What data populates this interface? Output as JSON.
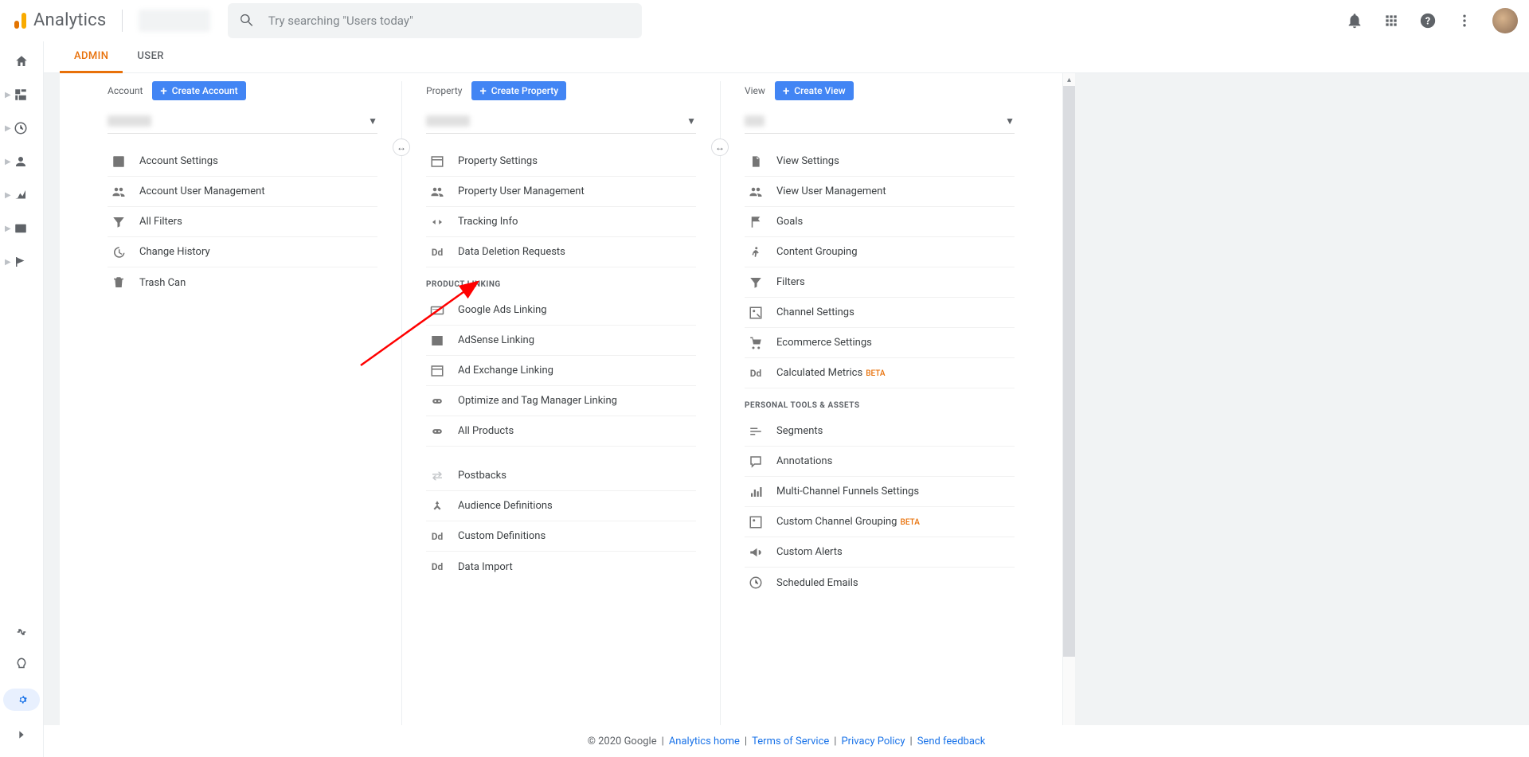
{
  "top": {
    "product": "Analytics",
    "search_placeholder": "Try searching \"Users today\""
  },
  "tabs": {
    "admin": "ADMIN",
    "user": "USER"
  },
  "account": {
    "head": "Account",
    "create": "Create Account",
    "items": [
      "Account Settings",
      "Account User Management",
      "All Filters",
      "Change History",
      "Trash Can"
    ]
  },
  "property": {
    "head": "Property",
    "create": "Create Property",
    "section_linking": "PRODUCT LINKING",
    "items_top": [
      "Property Settings",
      "Property User Management",
      "Tracking Info",
      "Data Deletion Requests"
    ],
    "items_linking": [
      "Google Ads Linking",
      "AdSense Linking",
      "Ad Exchange Linking",
      "Optimize and Tag Manager Linking",
      "All Products"
    ],
    "items_bottom": [
      "Postbacks",
      "Audience Definitions",
      "Custom Definitions",
      "Data Import"
    ]
  },
  "view": {
    "head": "View",
    "create": "Create View",
    "section_personal": "PERSONAL TOOLS & ASSETS",
    "items_top": [
      "View Settings",
      "View User Management",
      "Goals",
      "Content Grouping",
      "Filters",
      "Channel Settings",
      "Ecommerce Settings"
    ],
    "calc_metrics": "Calculated Metrics",
    "beta": "BETA",
    "items_personal": [
      "Segments",
      "Annotations",
      "Multi-Channel Funnels Settings"
    ],
    "custom_channel": "Custom Channel Grouping",
    "items_personal2": [
      "Custom Alerts",
      "Scheduled Emails"
    ]
  },
  "footer": {
    "copyright": "© 2020 Google",
    "analytics_home": "Analytics home",
    "tos": "Terms of Service",
    "privacy": "Privacy Policy",
    "feedback": "Send feedback"
  }
}
